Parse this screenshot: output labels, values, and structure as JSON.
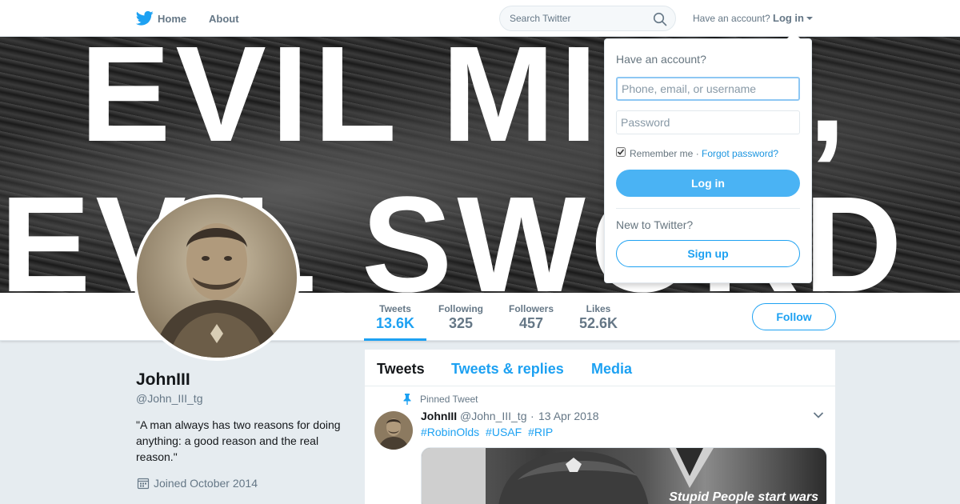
{
  "nav": {
    "home_label": "Home",
    "about_label": "About",
    "search_placeholder": "Search Twitter",
    "have_account": "Have an account?",
    "login_label": "Log in"
  },
  "banner": {
    "line1": "EVIL MIND,",
    "line2": "EVIL SWORD"
  },
  "stats": [
    {
      "label": "Tweets",
      "value": "13.6K"
    },
    {
      "label": "Following",
      "value": "325"
    },
    {
      "label": "Followers",
      "value": "457"
    },
    {
      "label": "Likes",
      "value": "52.6K"
    }
  ],
  "follow_label": "Follow",
  "profile": {
    "name": "JohnIII",
    "handle": "@John_III_tg",
    "bio": "\"A man always has two reasons for doing anything: a good reason and the real reason.\"",
    "joined": "Joined October 2014"
  },
  "timeline": {
    "tabs": [
      "Tweets",
      "Tweets & replies",
      "Media"
    ],
    "pinned_label": "Pinned Tweet",
    "tweet": {
      "name": "JohnIII",
      "handle": "@John_III_tg",
      "separator": "·",
      "date": "13 Apr 2018",
      "hashtags": [
        "#RobinOlds",
        "#USAF",
        "#RIP"
      ],
      "media_caption": "Stupid People start wars"
    }
  },
  "login_dropdown": {
    "title": "Have an account?",
    "username_placeholder": "Phone, email, or username",
    "password_placeholder": "Password",
    "remember_label": "Remember me ·",
    "forgot_label": "Forgot password?",
    "login_button": "Log in",
    "new_label": "New to Twitter?",
    "signup_button": "Sign up"
  },
  "colors": {
    "accent": "#1da1f2",
    "login_button_bg": "#4ab3f4",
    "muted_text": "#657786"
  }
}
